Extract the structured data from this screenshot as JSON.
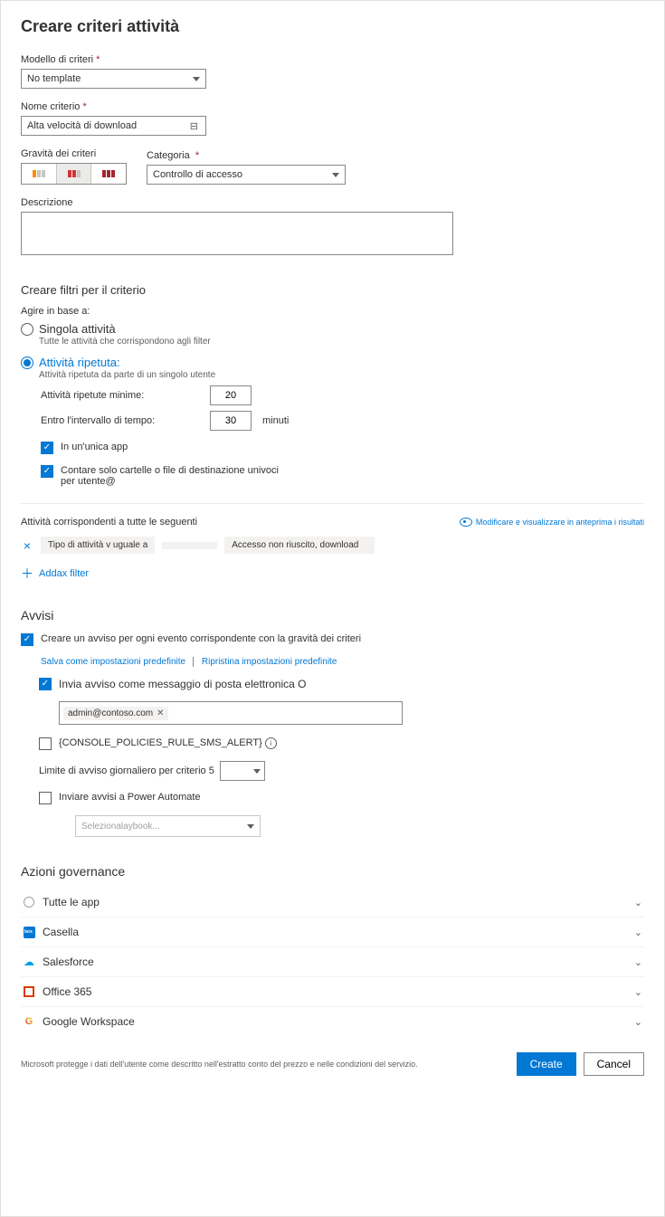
{
  "page_title": "Creare criteri attività",
  "template": {
    "label": "Modello di criteri",
    "value": "No template"
  },
  "name": {
    "label": "Nome criterio",
    "value": "Alta velocità di download"
  },
  "severity": {
    "label": "Gravità dei criteri"
  },
  "category": {
    "label": "Categoria",
    "value": "Controllo di accesso"
  },
  "description": {
    "label": "Descrizione"
  },
  "filters_header": "Creare filtri per il criterio",
  "act_on": "Agire in base a:",
  "single": {
    "title": "Singola attività",
    "sub": "Tutte le attività che corrispondono agli filter"
  },
  "repeated": {
    "title": "Attività ripetuta:",
    "sub": "Attività ripetuta da parte di un singolo utente"
  },
  "min_label": "Attività ripetute minime:",
  "min_value": "20",
  "interval_label": "Entro l'intervallo di tempo:",
  "interval_value": "30",
  "interval_unit": "minuti",
  "cb_single_app": "In un'unica app",
  "cb_unique": "Contare solo cartelle o file di destinazione univoci",
  "cb_unique2": "per utente@",
  "match_label": "Attività corrispondenti a tutte le seguenti",
  "preview_label": "Modificare e visualizzare in anteprima i risultati",
  "filter_type": "Tipo di attività v uguale a",
  "filter_value": "Accesso non riuscito, download",
  "add_filter": "Addax filter",
  "alerts_header": "Avvisi",
  "alert_main": "Creare un avviso per ogni evento corrispondente con la gravità dei criteri",
  "save_default": "Salva come impostazioni predefinite",
  "reset_default": "Ripristina impostazioni predefinite",
  "alert_email": "Invia avviso come messaggio di posta elettronica O",
  "email_addr": "admin@contoso.com",
  "alert_sms": "{CONSOLE_POLICIES_RULE_SMS_ALERT}",
  "daily_limit": "Limite di avviso giornaliero per criterio 5",
  "alert_pa": "Inviare avvisi a Power Automate",
  "pa_placeholder": "Selezionalaybook...",
  "gov_header": "Azioni governance",
  "gov_rows": [
    "Tutte le app",
    "Casella",
    "Salesforce",
    "Office 365",
    "Google Workspace"
  ],
  "footer_text": "Microsoft protegge i dati dell'utente come descritto nell'estratto conto del prezzo e nelle condizioni del servizio.",
  "btn_create": "Create",
  "btn_cancel": "Cancel"
}
